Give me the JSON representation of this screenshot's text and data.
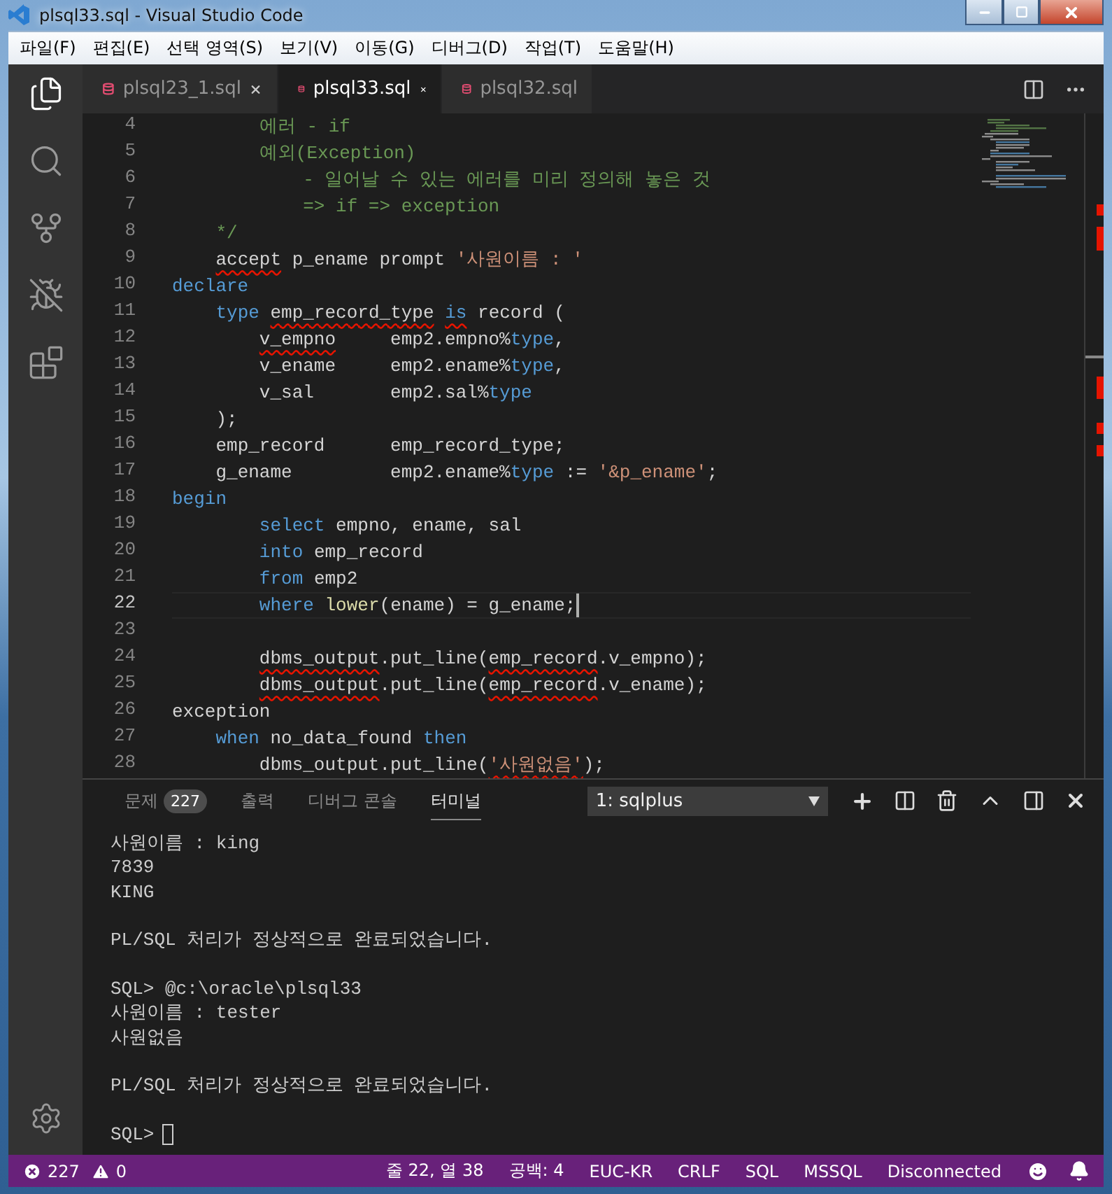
{
  "window": {
    "title": "plsql33.sql - Visual Studio Code"
  },
  "menu": [
    "파일(F)",
    "편집(E)",
    "선택 영역(S)",
    "보기(V)",
    "이동(G)",
    "디버그(D)",
    "작업(T)",
    "도움말(H)"
  ],
  "editor_tabs": [
    {
      "name": "plsql23_1.sql",
      "selected": false,
      "close_shown": true
    },
    {
      "name": "plsql33.sql",
      "selected": true,
      "close_shown": true
    },
    {
      "name": "plsql32.sql",
      "selected": false,
      "close_shown": false
    }
  ],
  "code_lines": [
    {
      "number": "4",
      "current": false,
      "tokens": [
        {
          "t": "        에러 - if",
          "kind": "comment",
          "squiggle": false
        }
      ]
    },
    {
      "number": "5",
      "current": false,
      "tokens": [
        {
          "t": "        예외(Exception)",
          "kind": "comment",
          "squiggle": false
        }
      ]
    },
    {
      "number": "6",
      "current": false,
      "tokens": [
        {
          "t": "            - 일어날 수 있는 에러를 미리 정의해 놓은 것",
          "kind": "comment",
          "squiggle": false
        }
      ]
    },
    {
      "number": "7",
      "current": false,
      "tokens": [
        {
          "t": "            => if => exception",
          "kind": "comment",
          "squiggle": false
        }
      ]
    },
    {
      "number": "8",
      "current": false,
      "tokens": [
        {
          "t": "    */",
          "kind": "comment",
          "squiggle": false
        }
      ]
    },
    {
      "number": "9",
      "current": false,
      "tokens": [
        {
          "t": "    accept",
          "kind": "plain",
          "squiggle": true
        },
        {
          "t": " p_ename prompt ",
          "kind": "plain",
          "squiggle": false
        },
        {
          "t": "'사원이름 : '",
          "kind": "string",
          "squiggle": false
        }
      ]
    },
    {
      "number": "10",
      "current": false,
      "tokens": [
        {
          "t": "declare",
          "kind": "keyword",
          "squiggle": false
        }
      ]
    },
    {
      "number": "11",
      "current": false,
      "tokens": [
        {
          "t": "    type",
          "kind": "keyword",
          "squiggle": false
        },
        {
          "t": " emp_record_type",
          "kind": "plain",
          "squiggle": true
        },
        {
          "t": " is",
          "kind": "keyword",
          "squiggle": true
        },
        {
          "t": " record (",
          "kind": "plain",
          "squiggle": false
        }
      ]
    },
    {
      "number": "12",
      "current": false,
      "tokens": [
        {
          "t": "        v_empno",
          "kind": "plain",
          "squiggle": true
        },
        {
          "t": "     emp2.empno%",
          "kind": "plain",
          "squiggle": false
        },
        {
          "t": "type",
          "kind": "keyword",
          "squiggle": false
        },
        {
          "t": ",",
          "kind": "plain",
          "squiggle": false
        }
      ]
    },
    {
      "number": "13",
      "current": false,
      "tokens": [
        {
          "t": "        v_ename     emp2.ename%",
          "kind": "plain",
          "squiggle": false
        },
        {
          "t": "type",
          "kind": "keyword",
          "squiggle": false
        },
        {
          "t": ",",
          "kind": "plain",
          "squiggle": false
        }
      ]
    },
    {
      "number": "14",
      "current": false,
      "tokens": [
        {
          "t": "        v_sal       emp2.sal%",
          "kind": "plain",
          "squiggle": false
        },
        {
          "t": "type",
          "kind": "keyword",
          "squiggle": false
        }
      ]
    },
    {
      "number": "15",
      "current": false,
      "tokens": [
        {
          "t": "    );",
          "kind": "plain",
          "squiggle": false
        }
      ]
    },
    {
      "number": "16",
      "current": false,
      "tokens": [
        {
          "t": "    emp_record      emp_record_type;",
          "kind": "plain",
          "squiggle": false
        }
      ]
    },
    {
      "number": "17",
      "current": false,
      "tokens": [
        {
          "t": "    g_ename         emp2.ename%",
          "kind": "plain",
          "squiggle": false
        },
        {
          "t": "type",
          "kind": "keyword",
          "squiggle": false
        },
        {
          "t": " := ",
          "kind": "plain",
          "squiggle": false
        },
        {
          "t": "'&p_ename'",
          "kind": "string",
          "squiggle": false
        },
        {
          "t": ";",
          "kind": "plain",
          "squiggle": false
        }
      ]
    },
    {
      "number": "18",
      "current": false,
      "tokens": [
        {
          "t": "begin",
          "kind": "keyword",
          "squiggle": false
        }
      ]
    },
    {
      "number": "19",
      "current": false,
      "tokens": [
        {
          "t": "        select",
          "kind": "keyword",
          "squiggle": false
        },
        {
          "t": " empno, ename, sal",
          "kind": "plain",
          "squiggle": false
        }
      ]
    },
    {
      "number": "20",
      "current": false,
      "tokens": [
        {
          "t": "        into",
          "kind": "keyword",
          "squiggle": false
        },
        {
          "t": " emp_record",
          "kind": "plain",
          "squiggle": false
        }
      ]
    },
    {
      "number": "21",
      "current": false,
      "tokens": [
        {
          "t": "        from",
          "kind": "keyword",
          "squiggle": false
        },
        {
          "t": " emp2",
          "kind": "plain",
          "squiggle": false
        }
      ]
    },
    {
      "number": "22",
      "current": true,
      "tokens": [
        {
          "t": "        where",
          "kind": "keyword",
          "squiggle": false
        },
        {
          "t": " lower",
          "kind": "function",
          "squiggle": false
        },
        {
          "t": "(ename) = g_ename;",
          "kind": "plain",
          "squiggle": false
        }
      ]
    },
    {
      "number": "23",
      "current": false
    },
    {
      "number": "24",
      "current": false,
      "tokens": [
        {
          "t": "        dbms_output",
          "kind": "plain",
          "squiggle": true
        },
        {
          "t": ".put_line(",
          "kind": "plain",
          "squiggle": false
        },
        {
          "t": "emp_record",
          "kind": "plain",
          "squiggle": true
        },
        {
          "t": ".v_empno);",
          "kind": "plain",
          "squiggle": false
        }
      ]
    },
    {
      "number": "25",
      "current": false,
      "tokens": [
        {
          "t": "        dbms_output",
          "kind": "plain",
          "squiggle": true
        },
        {
          "t": ".put_line(",
          "kind": "plain",
          "squiggle": false
        },
        {
          "t": "emp_record",
          "kind": "plain",
          "squiggle": true
        },
        {
          "t": ".v_ename);",
          "kind": "plain",
          "squiggle": false
        }
      ]
    },
    {
      "number": "26",
      "current": false,
      "tokens": [
        {
          "t": "exception",
          "kind": "plain",
          "squiggle": false
        }
      ]
    },
    {
      "number": "27",
      "current": false,
      "tokens": [
        {
          "t": "    when",
          "kind": "keyword",
          "squiggle": false
        },
        {
          "t": " no_data_found ",
          "kind": "plain",
          "squiggle": false
        },
        {
          "t": "then",
          "kind": "keyword",
          "squiggle": false
        }
      ]
    },
    {
      "number": "28",
      "current": false,
      "tokens": [
        {
          "t": "        dbms_output.put_line(",
          "kind": "plain",
          "squiggle": false
        },
        {
          "t": "'사원없음'",
          "kind": "string",
          "squiggle": true
        },
        {
          "t": ");",
          "kind": "plain",
          "squiggle": false
        }
      ]
    }
  ],
  "panel": {
    "tabs": [
      {
        "label": "문제",
        "badge": "227",
        "selected": false
      },
      {
        "label": "출력",
        "selected": false
      },
      {
        "label": "디버그 콘솔",
        "selected": false
      },
      {
        "label": "터미널",
        "selected": true
      }
    ],
    "terminal_select": "1: sqlplus"
  },
  "terminal": {
    "blocks": [
      [
        "사원이름 : king",
        "7839",
        "KING"
      ],
      [
        "PL/SQL 처리가 정상적으로 완료되었습니다."
      ],
      [
        "SQL> @c:\\oracle\\plsql33",
        "사원이름 : tester",
        "사원없음"
      ],
      [
        "PL/SQL 처리가 정상적으로 완료되었습니다."
      ],
      [
        "SQL>"
      ]
    ]
  },
  "status_bar": {
    "errors": "227",
    "warnings": "0",
    "items": [
      "줄 22, 열 38",
      "공백: 4",
      "EUC-KR",
      "CRLF",
      "SQL",
      "MSSQL",
      "Disconnected"
    ]
  }
}
